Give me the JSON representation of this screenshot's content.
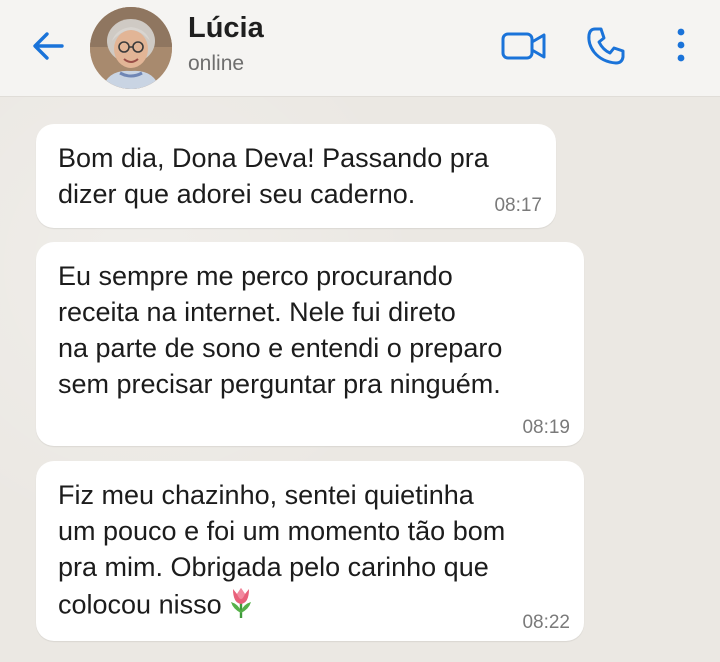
{
  "header": {
    "contact_name": "Lúcia",
    "status": "online",
    "icons": [
      "back-arrow-icon",
      "video-call-icon",
      "phone-call-icon",
      "more-options-icon"
    ],
    "accent_color": "#1a73d9"
  },
  "messages": [
    {
      "lines": [
        "Bom dia, Dona Deva! Passando pra",
        "dizer que adorei seu caderno."
      ],
      "time": "08:17"
    },
    {
      "lines": [
        "Eu sempre me perco procurando",
        "receita na internet. Nele fui direto",
        "na parte de sono e entendi o preparo",
        "sem precisar perguntar pra ninguém."
      ],
      "time": "08:19"
    },
    {
      "lines": [
        "Fiz meu chazinho, sentei quietinha",
        "um pouco e foi um momento tão bom",
        "pra mim. Obrigada pelo carinho que",
        "colocou nisso"
      ],
      "emoji": "tulip-emoji",
      "time": "08:22"
    }
  ]
}
